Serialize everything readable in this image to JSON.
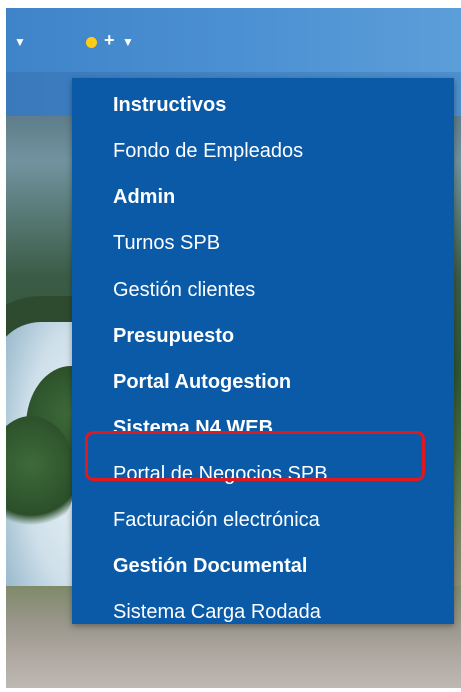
{
  "nav": {
    "status_color": "#ffcc1a",
    "icons": [
      "caret-down-icon",
      "status-dot-icon",
      "plus-icon",
      "caret-down-icon"
    ],
    "plus_symbol": "+"
  },
  "menu": {
    "background": "#0a5aa8",
    "highlight_color": "#e01820",
    "highlighted_item": "Portal de Negocios SPB",
    "items": [
      {
        "label": "Instructivos"
      },
      {
        "label": "Fondo de Empleados"
      },
      {
        "label": "Admin"
      },
      {
        "label": "Turnos SPB"
      },
      {
        "label": "Gestión clientes"
      },
      {
        "label": "Presupuesto"
      },
      {
        "label": "Portal Autogestion"
      },
      {
        "label": "Sistema N4 WEB"
      },
      {
        "label": "Portal de Negocios SPB"
      },
      {
        "label": "Facturación electrónica"
      },
      {
        "label": "Gestión Documental"
      },
      {
        "label": "Sistema Carga Rodada"
      }
    ]
  }
}
